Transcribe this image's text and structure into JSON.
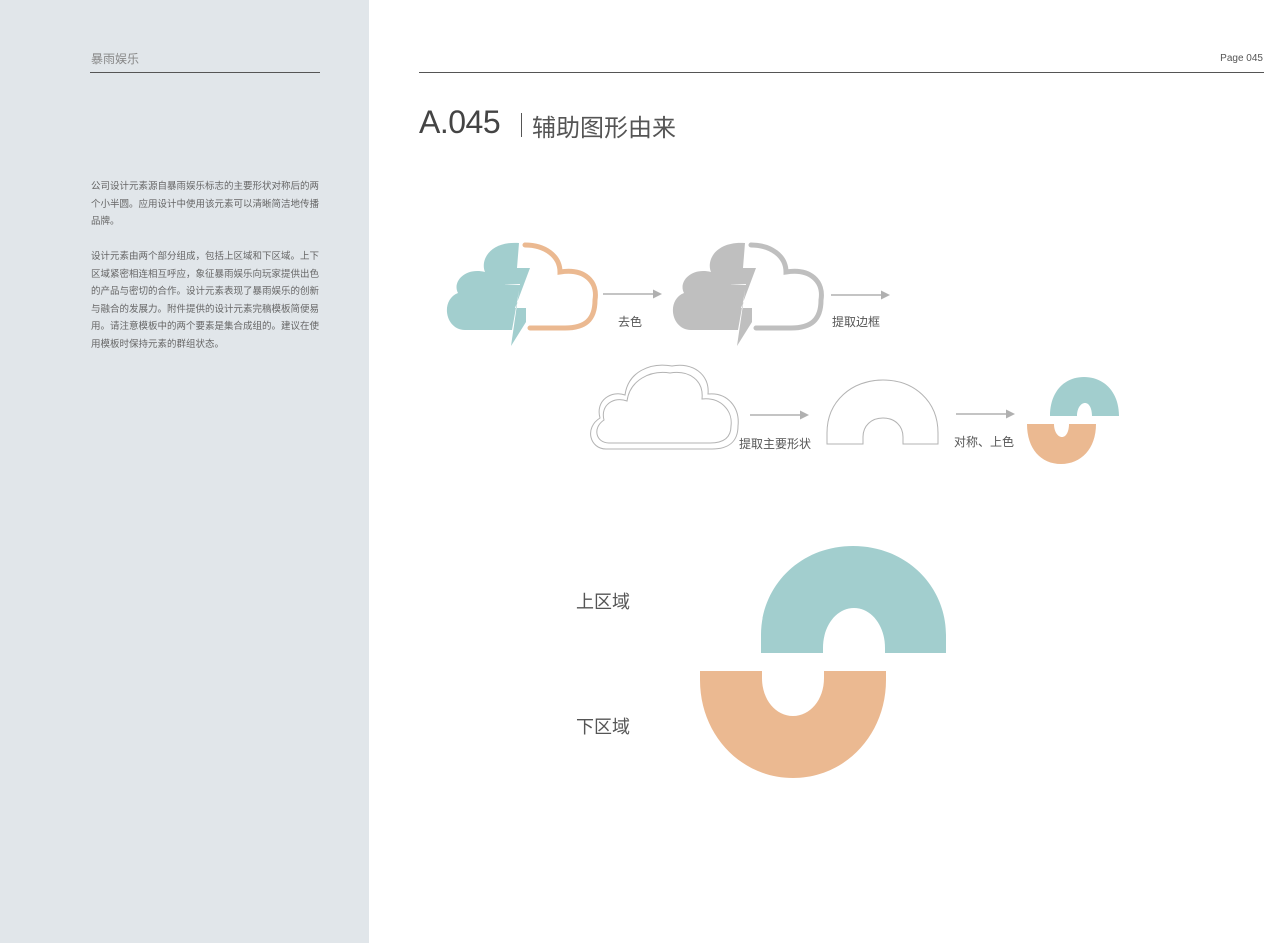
{
  "sidebar": {
    "brand": "暴雨娱乐",
    "paragraph1": "公司设计元素源自暴雨娱乐标志的主要形状对称后的两个小半圆。应用设计中使用该元素可以清晰简洁地传播品牌。",
    "paragraph2": "设计元素由两个部分组成，包括上区域和下区域。上下区域紧密相连相互呼应，象征暴雨娱乐向玩家提供出色的产品与密切的合作。设计元素表现了暴雨娱乐的创新与融合的发展力。附件提供的设计元素完稿模板简便易用。请注意模板中的两个要素是集合成组的。建议在使用模板时保持元素的群组状态。"
  },
  "header": {
    "page_number": "Page 045",
    "code": "A.045",
    "title": "辅助图形由来"
  },
  "steps": {
    "step1": "去色",
    "step2": "提取边框",
    "step3": "提取主要形状",
    "step4": "对称、上色"
  },
  "regions": {
    "upper": "上区域",
    "lower": "下区域"
  },
  "colors": {
    "teal": "#a2cece",
    "orange": "#ebb991",
    "gray": "#bfbfbf",
    "outline": "#b3b3b3",
    "arrow": "#b0b0b0",
    "sidebar_bg": "#e1e6ea"
  }
}
